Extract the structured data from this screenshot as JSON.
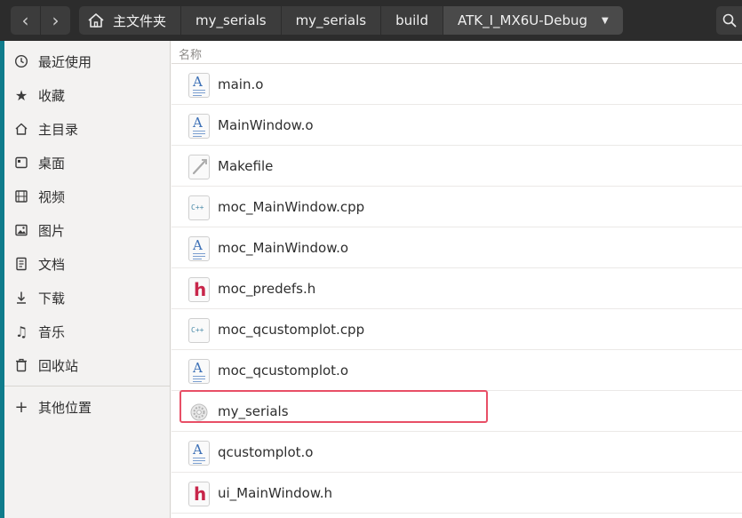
{
  "header": {
    "back_label": "‹",
    "forward_label": "›",
    "breadcrumbs": [
      "主文件夹",
      "my_serials",
      "my_serials",
      "build",
      "ATK_I_MX6U-Debug"
    ]
  },
  "sidebar": {
    "items": [
      {
        "label": "最近使用",
        "icon": "clock-icon"
      },
      {
        "label": "收藏",
        "icon": "star-icon"
      },
      {
        "label": "主目录",
        "icon": "home-icon"
      },
      {
        "label": "桌面",
        "icon": "desktop-icon"
      },
      {
        "label": "视频",
        "icon": "video-icon"
      },
      {
        "label": "图片",
        "icon": "image-icon"
      },
      {
        "label": "文档",
        "icon": "document-icon"
      },
      {
        "label": "下载",
        "icon": "download-icon"
      },
      {
        "label": "音乐",
        "icon": "music-icon"
      },
      {
        "label": "回收站",
        "icon": "trash-icon"
      },
      {
        "label": "其他位置",
        "icon": "plus-icon"
      }
    ]
  },
  "main": {
    "column_header": "名称",
    "files": [
      {
        "name": "main.o",
        "type": "object"
      },
      {
        "name": "MainWindow.o",
        "type": "object"
      },
      {
        "name": "Makefile",
        "type": "makefile"
      },
      {
        "name": "moc_MainWindow.cpp",
        "type": "cpp"
      },
      {
        "name": "moc_MainWindow.o",
        "type": "object"
      },
      {
        "name": "moc_predefs.h",
        "type": "header"
      },
      {
        "name": "moc_qcustomplot.cpp",
        "type": "cpp"
      },
      {
        "name": "moc_qcustomplot.o",
        "type": "object"
      },
      {
        "name": "my_serials",
        "type": "executable"
      },
      {
        "name": "qcustomplot.o",
        "type": "object"
      },
      {
        "name": "ui_MainWindow.h",
        "type": "header"
      }
    ]
  },
  "colors": {
    "highlight": "#e84f66",
    "header_bg": "#2c2c2c",
    "header_text": "#f0f0f0",
    "object_icon": "#3b6fb6",
    "header_icon": "#c8264a"
  }
}
